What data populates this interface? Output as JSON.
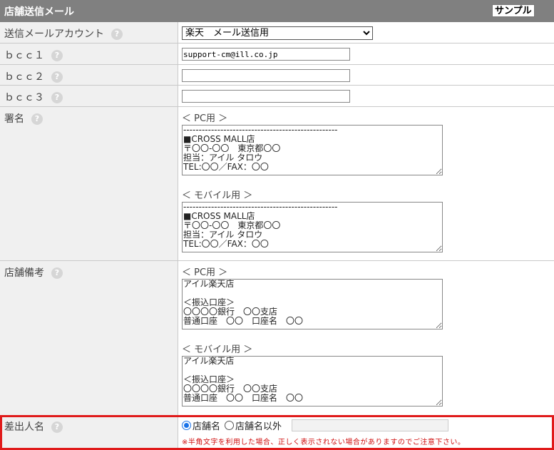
{
  "header": {
    "title": "店舗送信メール",
    "sample_button": "サンプル"
  },
  "rows": {
    "account": {
      "label": "送信メールアカウント",
      "value": "楽天　メール送信用"
    },
    "bcc1": {
      "label": "ｂｃｃ１",
      "value": "support-cm@ill.co.jp"
    },
    "bcc2": {
      "label": "ｂｃｃ２",
      "value": ""
    },
    "bcc3": {
      "label": "ｂｃｃ３",
      "value": ""
    },
    "signature": {
      "label": "署名",
      "pc_label": "＜ PC用 ＞",
      "pc_text": "--------------------------------------------------\n■CROSS MALL店\n〒〇〇-〇〇　東京都〇〇\n担当：アイル タロウ\nTEL:〇〇／FAX：〇〇",
      "mobile_label": "＜ モバイル用 ＞",
      "mobile_text": "--------------------------------------------------\n■CROSS MALL店\n〒〇〇-〇〇　東京都〇〇\n担当：アイル タロウ\nTEL:〇〇／FAX：〇〇"
    },
    "remarks": {
      "label": "店舗備考",
      "pc_label": "＜ PC用 ＞",
      "pc_text": "アイル楽天店\n\n＜振込口座＞\n〇〇〇〇銀行　〇〇支店\n普通口座　〇〇　口座名　〇〇",
      "mobile_label": "＜ モバイル用 ＞",
      "mobile_text": "アイル楽天店\n\n＜振込口座＞\n〇〇〇〇銀行　〇〇支店\n普通口座　〇〇　口座名　〇〇"
    },
    "sender": {
      "label": "差出人名",
      "option_store": "店舗名",
      "option_other": "店舗名以外",
      "other_value": "",
      "notice": "※半角文字を利用した場合、正しく表示されない場合がありますのでご注意下さい。"
    }
  },
  "help_glyph": "?",
  "colors": {
    "header_bg": "#808080",
    "label_bg": "#f0f0f0",
    "highlight_border": "#e01a1a",
    "notice_text": "#d01010"
  }
}
